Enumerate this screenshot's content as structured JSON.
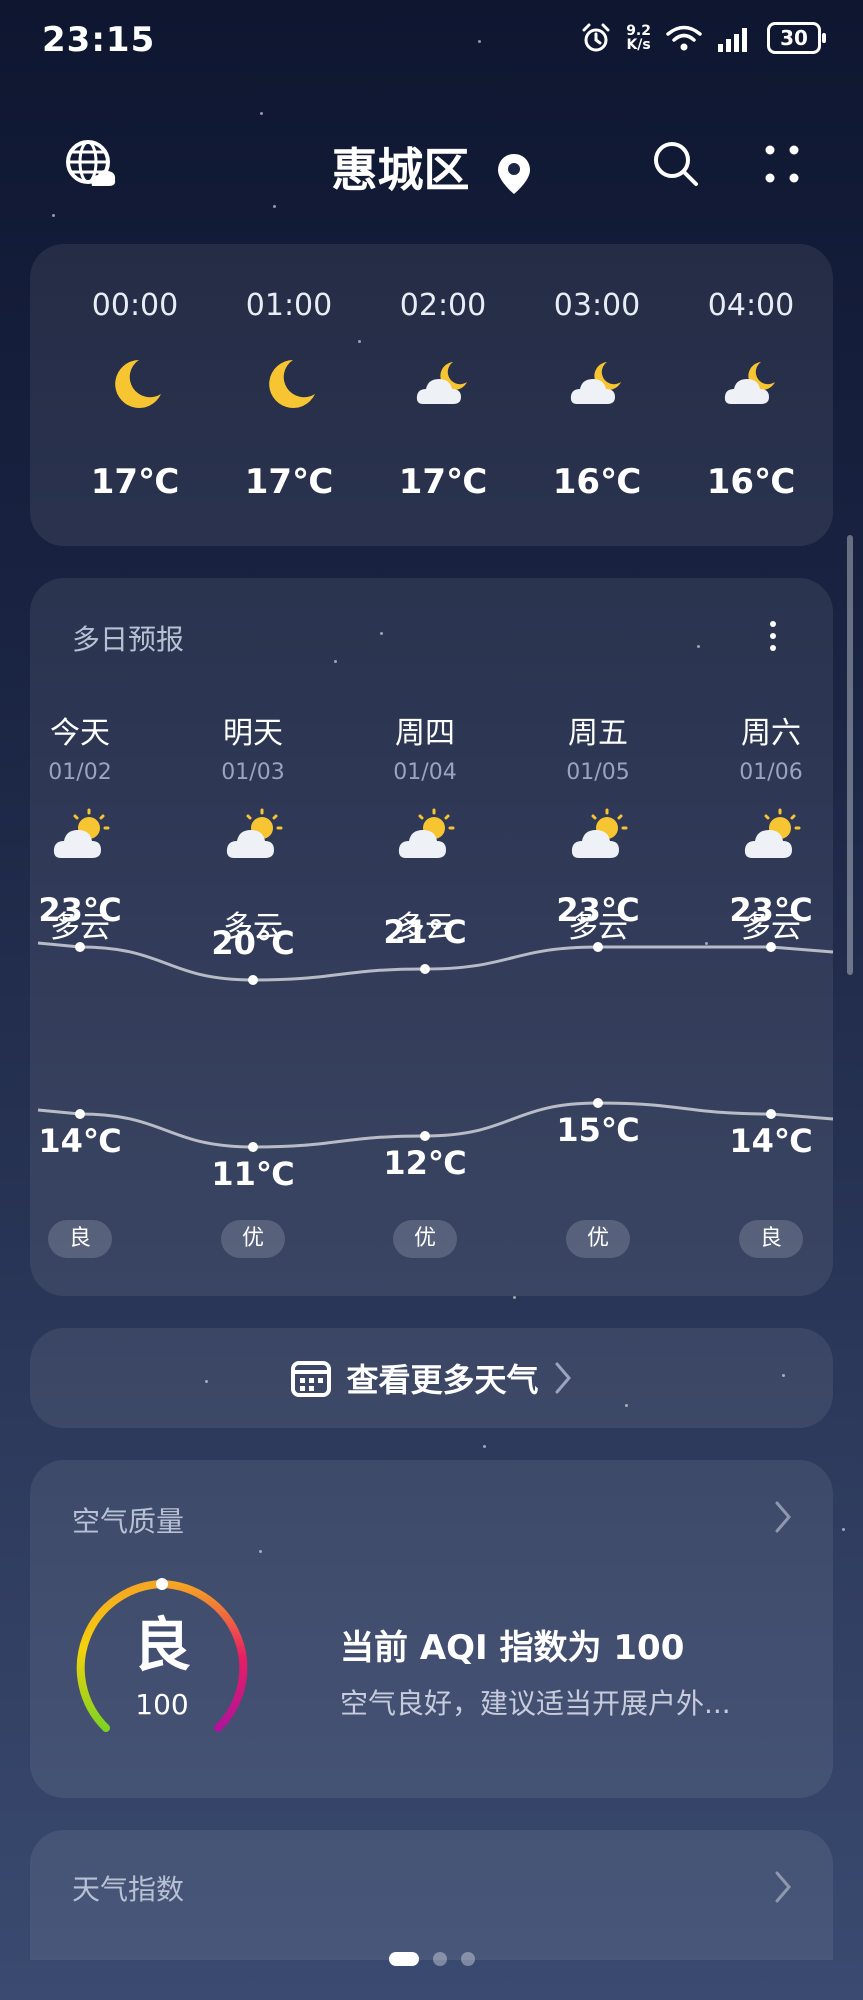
{
  "status_bar": {
    "time": "23:15",
    "net_speed_value": "9.2",
    "net_speed_unit": "K/s",
    "battery": "30"
  },
  "header": {
    "location": "惠城区"
  },
  "hourly": [
    {
      "time": "00:00",
      "icon": "moon",
      "temp": "17℃"
    },
    {
      "time": "01:00",
      "icon": "moon",
      "temp": "17℃"
    },
    {
      "time": "02:00",
      "icon": "moon-cloud",
      "temp": "17℃"
    },
    {
      "time": "03:00",
      "icon": "moon-cloud",
      "temp": "16℃"
    },
    {
      "time": "04:00",
      "icon": "moon-cloud",
      "temp": "16℃"
    }
  ],
  "daily": {
    "title": "多日预报",
    "days": [
      {
        "name": "今天",
        "date": "01/02",
        "icon": "sun-cloud",
        "condition": "多云",
        "high": 23,
        "low": 14,
        "high_label": "23℃",
        "low_label": "14℃",
        "aqi": "良"
      },
      {
        "name": "明天",
        "date": "01/03",
        "icon": "sun-cloud",
        "condition": "多云",
        "high": 20,
        "low": 11,
        "high_label": "20℃",
        "low_label": "11℃",
        "aqi": "优"
      },
      {
        "name": "周四",
        "date": "01/04",
        "icon": "sun-cloud",
        "condition": "多云",
        "high": 21,
        "low": 12,
        "high_label": "21℃",
        "low_label": "12℃",
        "aqi": "优"
      },
      {
        "name": "周五",
        "date": "01/05",
        "icon": "sun-cloud",
        "condition": "多云",
        "high": 23,
        "low": 15,
        "high_label": "23℃",
        "low_label": "15℃",
        "aqi": "优"
      },
      {
        "name": "周六",
        "date": "01/06",
        "icon": "sun-cloud",
        "condition": "多云",
        "high": 23,
        "low": 14,
        "high_label": "23℃",
        "low_label": "14℃",
        "aqi": "良"
      }
    ]
  },
  "more_weather": {
    "label": "查看更多天气"
  },
  "air_quality": {
    "title": "空气质量",
    "grade": "良",
    "aqi": "100",
    "headline": "当前 AQI 指数为 100",
    "advice": "空气良好，建议适当开展户外..."
  },
  "weather_index": {
    "title": "天气指数"
  },
  "pager": {
    "count": 3,
    "active": 0
  },
  "colors": {
    "moon": "#f7c531",
    "sun": "#f7c531",
    "cloud": "#eef1f6"
  }
}
